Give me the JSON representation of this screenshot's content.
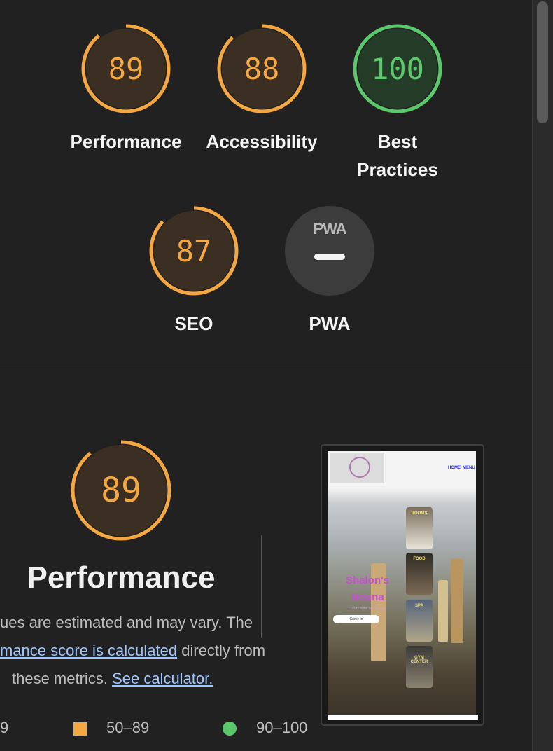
{
  "scores": [
    {
      "label": "Performance",
      "value": "89",
      "score": 89,
      "color": "#f5a742"
    },
    {
      "label": "Accessibility",
      "value": "88",
      "score": 88,
      "color": "#f5a742"
    },
    {
      "label_line1": "Best",
      "label_line2": "Practices",
      "value": "100",
      "score": 100,
      "color": "#5ac86b"
    },
    {
      "label": "SEO",
      "value": "87",
      "score": 87,
      "color": "#f5a742"
    }
  ],
  "pwa": {
    "badge": "PWA",
    "label": "PWA"
  },
  "performance_section": {
    "score_value": "89",
    "score": 89,
    "title": "Performance",
    "desc_line1": "ues are estimated and may vary. The",
    "desc_link1": "mance score is calculated",
    "desc_line2_rest": "directly from",
    "desc_line3": "these metrics.",
    "desc_link2": "See calculator.",
    "legend": {
      "partial": "9",
      "average": "50–89",
      "good": "90–100"
    }
  },
  "thumbnail": {
    "nav_home": "HOME",
    "nav_menu": "MENU",
    "card_rooms": "ROOMS",
    "card_food": "FOOD",
    "card_spa": "SPA",
    "card_gym": "GYM CENTER",
    "hero_line1": "Shalon's",
    "hero_line2": "Nouna",
    "hero_sub": "Luxury hotel and lounge",
    "hero_button": "Come In"
  },
  "colors": {
    "average": "#f5a742",
    "good": "#5ac86b",
    "background": "#212121"
  }
}
